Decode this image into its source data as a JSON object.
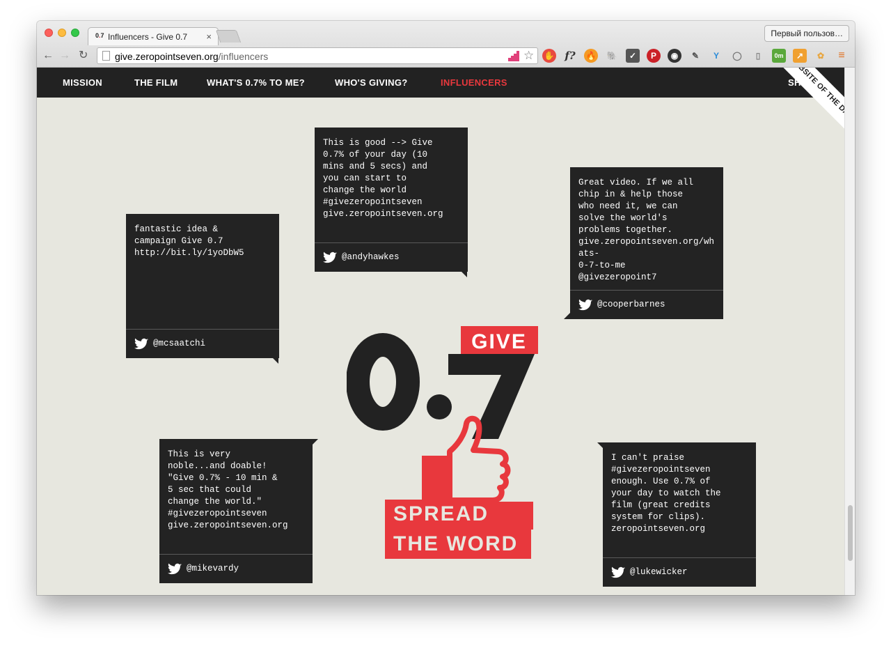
{
  "browser": {
    "tab_title": "Influencers - Give 0.7",
    "tab_close": "×",
    "profile": "Первый пользов…",
    "url_host": "give.zeropointseven.org",
    "url_path": "/influencers",
    "back": "←",
    "forward": "→",
    "reload": "↻",
    "star": "☆"
  },
  "nav": {
    "items": [
      {
        "label": "MISSION",
        "active": false
      },
      {
        "label": "THE FILM",
        "active": false
      },
      {
        "label": "WHAT'S 0.7% TO ME?",
        "active": false
      },
      {
        "label": "WHO'S GIVING?",
        "active": false
      },
      {
        "label": "INFLUENCERS",
        "active": true
      }
    ],
    "share": "SHARE"
  },
  "badge": "WEBSITE OF THE DAY",
  "logo": {
    "give": "GIVE",
    "number": "0.7",
    "line1": "SPREAD",
    "line2": "THE WORD"
  },
  "tweets": [
    {
      "text": "fantastic idea &\ncampaign Give 0.7\nhttp://bit.ly/1yoDbW5",
      "handle": "@mcsaatchi"
    },
    {
      "text": "This is good --> Give\n0.7% of your day (10\nmins and 5 secs) and\nyou can start to\nchange the world\n#givezeropointseven\ngive.zeropointseven.org",
      "handle": "@andyhawkes"
    },
    {
      "text": "Great video. If we all\nchip in & help those\nwho need it, we can\nsolve the world's\nproblems together.\ngive.zeropointseven.org/whats-\n0-7-to-me\n@givezeropoint7",
      "handle": "@cooperbarnes"
    },
    {
      "text": "This is very\nnoble...and doable!\n\"Give 0.7% - 10 min &\n5 sec that could\nchange the world.\"\n#givezeropointseven\ngive.zeropointseven.org",
      "handle": "@mikevardy"
    },
    {
      "text": "I can't praise\n#givezeropointseven\nenough. Use 0.7% of\nyour day to watch the\nfilm (great credits\nsystem for clips).\nzeropointseven.org",
      "handle": "@lukewicker"
    }
  ],
  "colors": {
    "accent": "#e8383d",
    "dark": "#222222",
    "background": "#e7e7df"
  }
}
